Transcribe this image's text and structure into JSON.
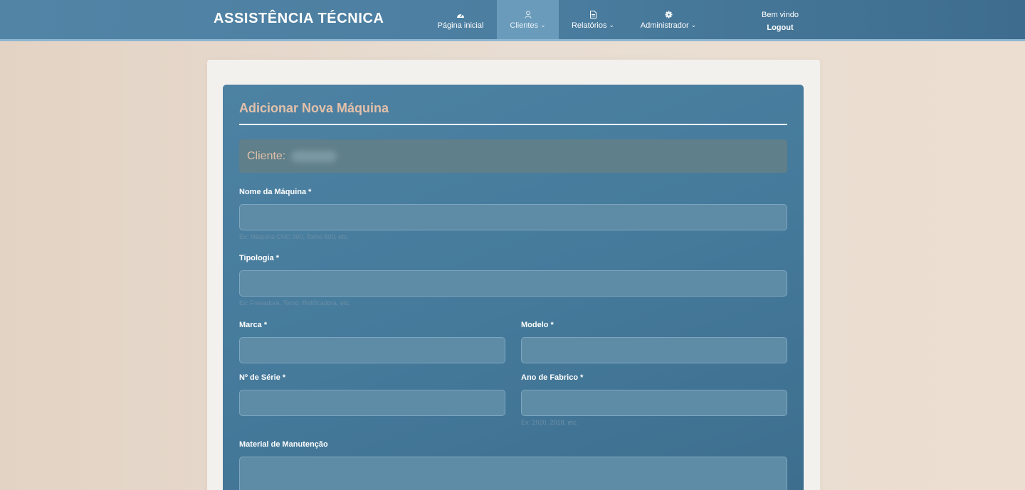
{
  "brand": "ASSISTÊNCIA TÉCNICA",
  "nav": {
    "home": "Página inicial",
    "clients": "Clientes",
    "reports": "Relatórios",
    "admin": "Administrador",
    "welcome": "Bem vindo",
    "logout": "Logout",
    "chevron": "⌄"
  },
  "icons": {
    "home": "gauge-icon",
    "clients": "user-icon",
    "reports": "document-icon",
    "admin": "gear-icon"
  },
  "form": {
    "title": "Adicionar Nova Máquina",
    "client_label": "Cliente:",
    "fields": {
      "machine_name": {
        "label": "Nome da Máquina *",
        "value": "",
        "help": "Ex: Máquina CNC 300, Torno 500, etc."
      },
      "typology": {
        "label": "Tipologia *",
        "value": "",
        "help": "Ex: Fresadora, Torno, Retificadora, etc."
      },
      "brand": {
        "label": "Marca *",
        "value": ""
      },
      "model": {
        "label": "Modelo *",
        "value": ""
      },
      "serial": {
        "label": "Nº de Série *",
        "value": ""
      },
      "year": {
        "label": "Ano de Fabrico *",
        "value": "",
        "help": "Ex: 2020, 2018, etc."
      },
      "maintenance": {
        "label": "Material de Manutenção",
        "value": ""
      }
    }
  },
  "colors": {
    "navbar": "#4b7ea0",
    "panel": "#457a9b",
    "title": "#e3c0a9",
    "background": "#e6d8ca"
  }
}
